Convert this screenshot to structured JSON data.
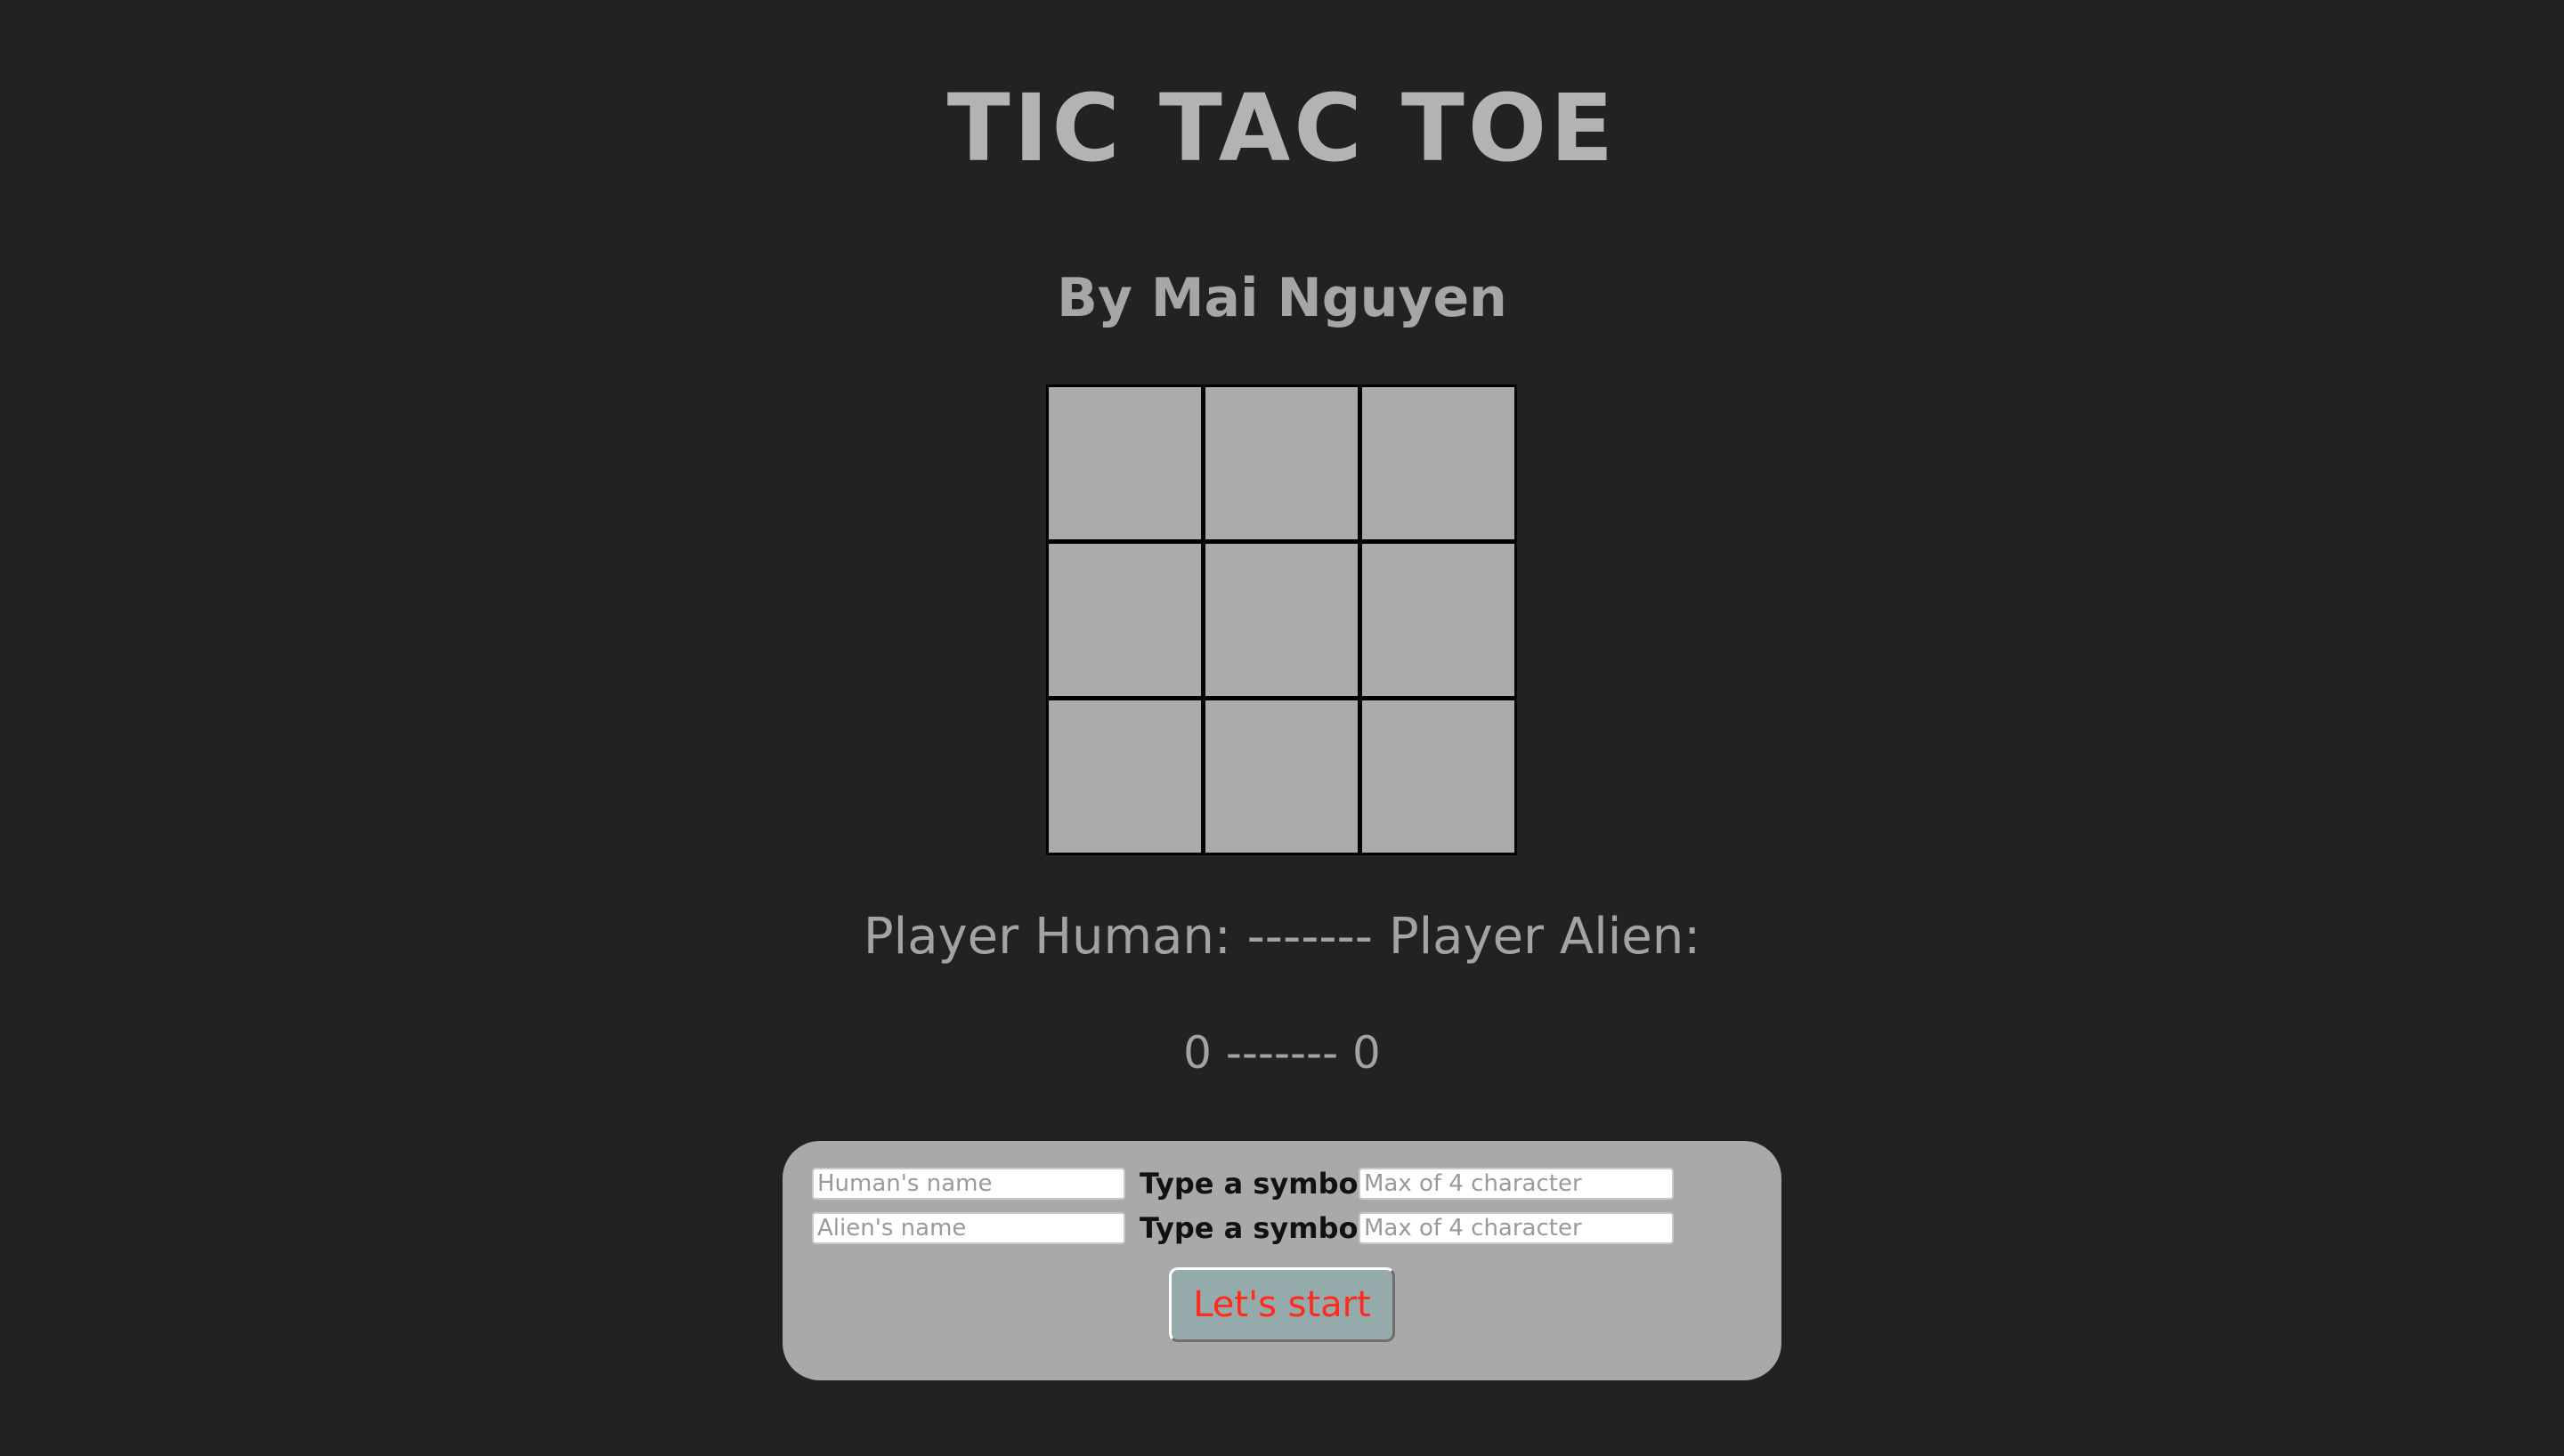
{
  "header": {
    "title": "TIC TAC TOE",
    "author": "By Mai Nguyen"
  },
  "board": {
    "cells": [
      "",
      "",
      "",
      "",
      "",
      "",
      "",
      "",
      ""
    ]
  },
  "scoreboard": {
    "players_line": "Player Human: ------- Player Alien:",
    "scores_line": "0 ------- 0"
  },
  "setup_form": {
    "human_name_placeholder": "Human's name",
    "human_name_value": "",
    "human_symbol_label": "Type a symbol:",
    "human_symbol_placeholder": "Max of 4 character",
    "human_symbol_value": "",
    "alien_name_placeholder": "Alien's name",
    "alien_name_value": "",
    "alien_symbol_label": "Type a symbol:",
    "alien_symbol_placeholder": "Max of 4 character",
    "alien_symbol_value": "",
    "start_label": "Let's start"
  },
  "colors": {
    "background": "#222222",
    "board_cell": "#aaaaaa",
    "panel": "#a9a9a9",
    "button": "#95abab",
    "button_text": "#ff2a1a"
  }
}
